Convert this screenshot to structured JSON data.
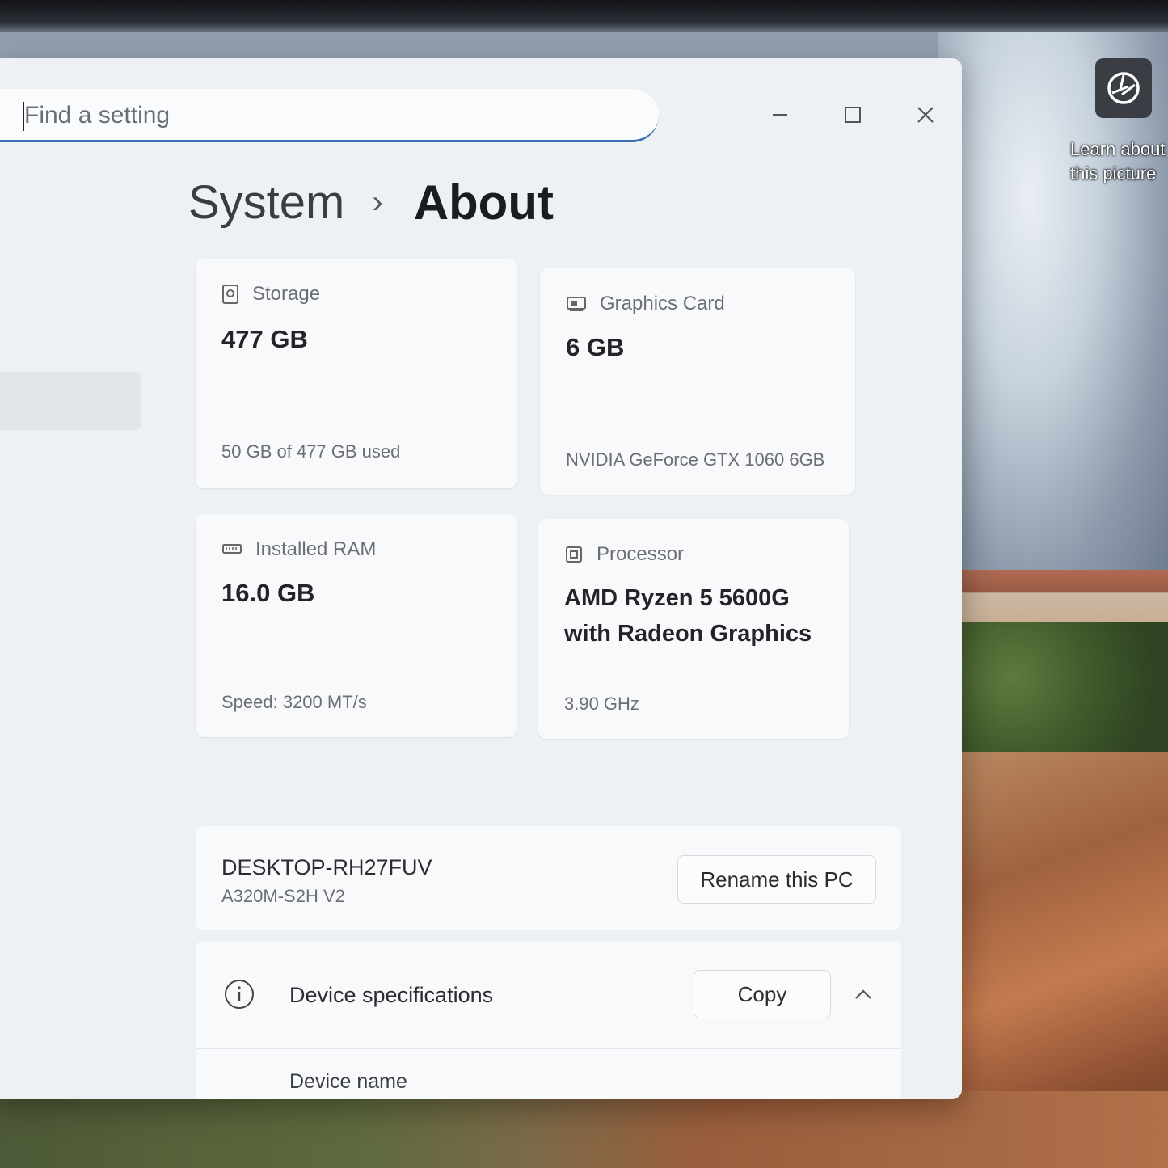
{
  "desktop": {
    "shortcut_label_line1": "Learn about",
    "shortcut_label_line2": "this picture",
    "shortcut_icon": "camera-lens-icon"
  },
  "search": {
    "placeholder": "Find a setting"
  },
  "window_controls": {
    "minimize_icon": "minimize-icon",
    "maximize_icon": "maximize-icon",
    "close_icon": "close-icon"
  },
  "breadcrumb": {
    "parent": "System",
    "separator": "›",
    "current": "About"
  },
  "specs_cards": {
    "storage": {
      "label": "Storage",
      "value": "477 GB",
      "detail": "50 GB of 477 GB used",
      "icon": "storage-icon"
    },
    "graphics": {
      "label": "Graphics Card",
      "value": "6 GB",
      "detail": "NVIDIA GeForce GTX 1060 6GB",
      "icon": "graphics-card-icon"
    },
    "ram": {
      "label": "Installed RAM",
      "value": "16.0 GB",
      "detail": "Speed: 3200 MT/s",
      "icon": "ram-icon"
    },
    "processor": {
      "label": "Processor",
      "value_line1": "AMD Ryzen 5 5600G",
      "value_line2": "with Radeon Graphics",
      "detail": "3.90 GHz",
      "icon": "processor-icon"
    }
  },
  "device": {
    "name": "DESKTOP-RH27FUV",
    "model": "A320M-S2H V2",
    "rename_button": "Rename this PC"
  },
  "device_specifications": {
    "title": "Device specifications",
    "copy_button": "Copy",
    "first_row_label": "Device name",
    "info_icon": "info-icon",
    "collapse_icon": "chevron-up-icon"
  }
}
